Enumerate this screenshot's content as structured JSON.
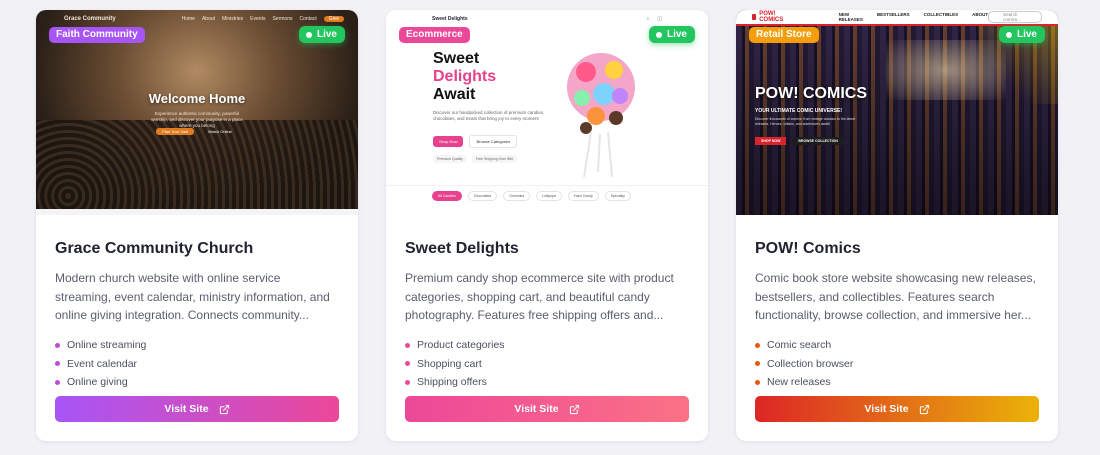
{
  "cards": [
    {
      "badge": "Faith Community",
      "badge_color": "#a855f7",
      "live": "Live",
      "title": "Grace Community Church",
      "description": "Modern church website with online service streaming, event calendar, ministry information, and online giving integration. Connects community...",
      "features": [
        "Online streaming",
        "Event calendar",
        "Online giving"
      ],
      "feature_dot_color": "#c04ad6",
      "button": "Visit Site",
      "button_gradient": [
        "#a855f7",
        "#ec4899"
      ],
      "preview": {
        "brand": "Grace Community",
        "nav": [
          "Home",
          "About",
          "Ministries",
          "Events",
          "Sermons",
          "Contact"
        ],
        "nav_cta": "Give",
        "hero_title": "Welcome Home",
        "hero_sub": "Experience authentic community, powerful worship, and discover your purpose in a place where you belong",
        "btn_primary": "Plan Your Visit",
        "btn_secondary": "Watch Online"
      }
    },
    {
      "badge": "Ecommerce",
      "badge_color": "#ec4899",
      "live": "Live",
      "title": "Sweet Delights",
      "description": "Premium candy shop ecommerce site with product categories, shopping cart, and beautiful candy photography. Features free shipping offers and...",
      "features": [
        "Product categories",
        "Shopping cart",
        "Shipping offers"
      ],
      "feature_dot_color": "#ec4899",
      "button": "Visit Site",
      "button_gradient": [
        "#ec4899",
        "#fb7185"
      ],
      "preview": {
        "brand": "Sweet Delights",
        "hero_line1": "Sweet",
        "hero_line2": "Delights",
        "hero_line3": "Await",
        "hero_sub": "Discover our handpicked collection of premium candies, chocolates, and treats that bring joy to every moment",
        "btn_primary": "Shop Now",
        "btn_secondary": "Browse Categories",
        "chips": [
          "Premium Quality",
          "Free Shipping Over $50"
        ],
        "tabs": [
          "All Candies",
          "Chocolates",
          "Gummies",
          "Lollipops",
          "Hard Candy",
          "Specialty"
        ]
      }
    },
    {
      "badge": "Retail Store",
      "badge_color": "#f59e0b",
      "live": "Live",
      "title": "POW! Comics",
      "description": "Comic book store website showcasing new releases, bestsellers, and collectibles. Features search functionality, browse collection, and immersive her...",
      "features": [
        "Comic search",
        "Collection browser",
        "New releases"
      ],
      "feature_dot_color": "#ea580c",
      "button": "Visit Site",
      "button_gradient": [
        "#dc2626",
        "#eab308"
      ],
      "preview": {
        "brand": "POW! COMICS",
        "nav": [
          "NEW RELEASES",
          "BESTSELLERS",
          "COLLECTIBLES",
          "ABOUT"
        ],
        "search": "Search comics...",
        "hero_title": "POW! COMICS",
        "hero_tag": "YOUR ULTIMATE COMIC UNIVERSE!",
        "hero_sub": "Discover thousands of comics, from vintage classics to the latest releases. Heroes, villains, and adventures await!",
        "btn_primary": "SHOP NOW",
        "btn_secondary": "BROWSE COLLECTION"
      }
    }
  ]
}
